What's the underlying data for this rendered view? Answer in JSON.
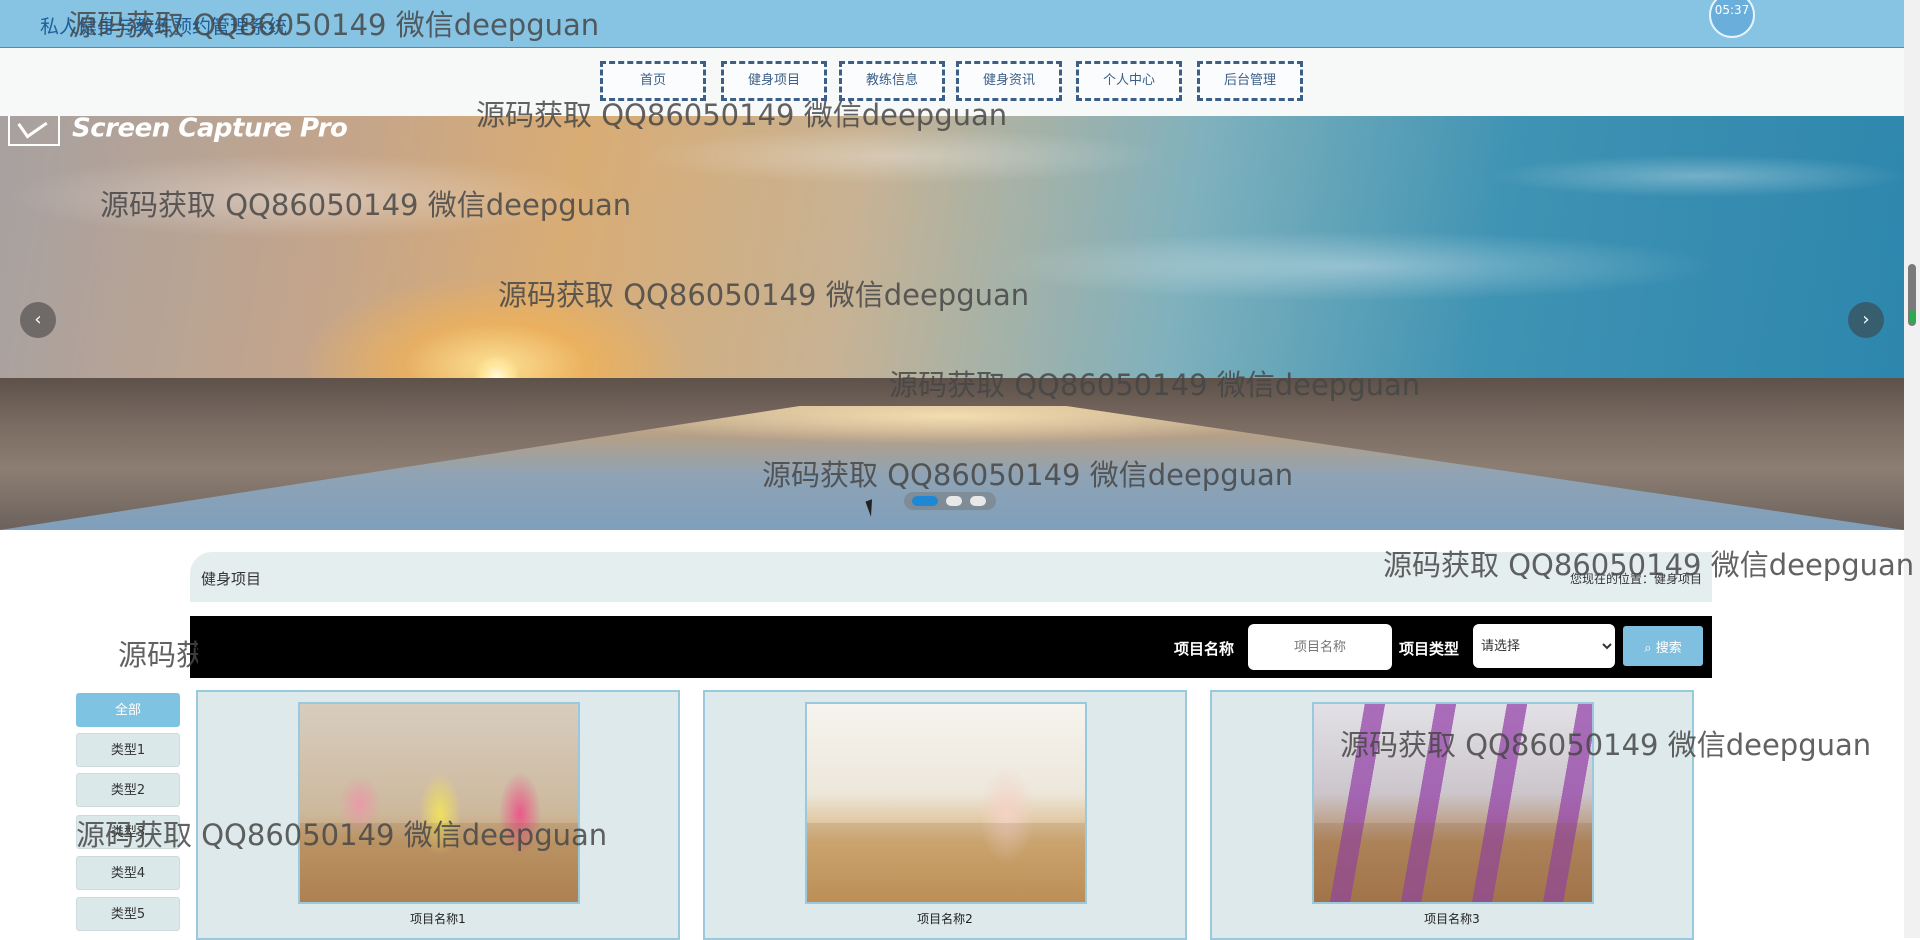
{
  "header": {
    "site_title": "私人健身与教练预约管理系统",
    "clock": "05:37"
  },
  "nav": {
    "items": [
      "首页",
      "健身项目",
      "教练信息",
      "健身资讯",
      "个人中心",
      "后台管理"
    ]
  },
  "banner": {
    "logo_text": "Screen Capture Pro",
    "prev_icon": "chevron-left-icon",
    "next_icon": "chevron-right-icon",
    "slides": 3,
    "active_slide": 1
  },
  "section": {
    "title": "健身项目",
    "breadcrumb": "您现在的位置：健身项目"
  },
  "search": {
    "name_label": "项目名称",
    "name_placeholder": "项目名称",
    "type_label": "项目类型",
    "type_selected": "请选择",
    "button_label": "搜索",
    "button_icon": "search-icon"
  },
  "categories": [
    "全部",
    "类型1",
    "类型2",
    "类型3",
    "类型4",
    "类型5"
  ],
  "projects": [
    {
      "name": "项目名称1"
    },
    {
      "name": "项目名称2"
    },
    {
      "name": "项目名称3"
    }
  ],
  "watermark": "源码获取 QQ86050149 微信deepguan",
  "colors": {
    "topbar": "#87c4e4",
    "nav_border": "#3b5f88",
    "accent": "#7fc0e0",
    "card_bg": "#dde9ea"
  }
}
